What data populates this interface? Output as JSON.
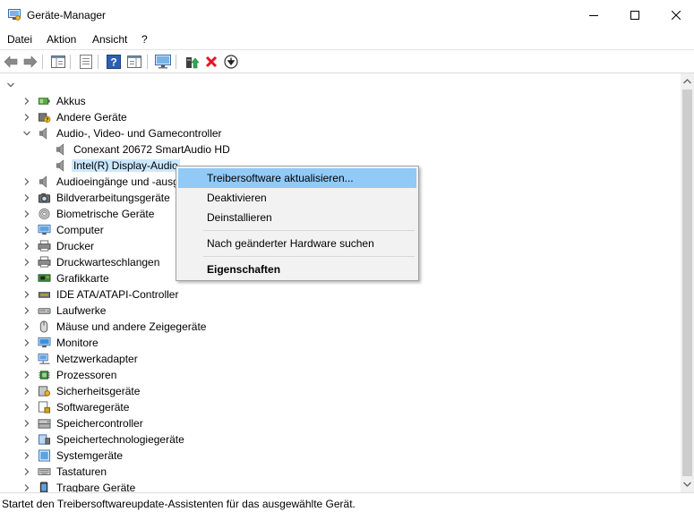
{
  "window": {
    "title": "Geräte-Manager"
  },
  "menu": [
    {
      "label": "Datei"
    },
    {
      "label": "Aktion"
    },
    {
      "label": "Ansicht"
    },
    {
      "label": "?"
    }
  ],
  "tree": {
    "root_label": "",
    "categories": [
      {
        "label": "Akkus",
        "icon": "battery-icon"
      },
      {
        "label": "Andere Geräte",
        "icon": "unknown-device-icon"
      },
      {
        "label": "Audio-, Video- und Gamecontroller",
        "icon": "speaker-icon",
        "expanded": true
      },
      {
        "label": "Conexant 20672 SmartAudio HD",
        "icon": "speaker-icon",
        "child": true
      },
      {
        "label": "Intel(R) Display-Audio",
        "icon": "speaker-icon",
        "child": true,
        "selected": true
      },
      {
        "label": "Audioeingänge und -ausgänge",
        "icon": "speaker-icon"
      },
      {
        "label": "Bildverarbeitungsgeräte",
        "icon": "camera-icon"
      },
      {
        "label": "Biometrische Geräte",
        "icon": "fingerprint-icon"
      },
      {
        "label": "Computer",
        "icon": "computer-icon"
      },
      {
        "label": "Drucker",
        "icon": "printer-icon"
      },
      {
        "label": "Druckwarteschlangen",
        "icon": "printer-icon"
      },
      {
        "label": "Grafikkarte",
        "icon": "display-adapter-icon"
      },
      {
        "label": "IDE ATA/ATAPI-Controller",
        "icon": "ide-controller-icon"
      },
      {
        "label": "Laufwerke",
        "icon": "disk-drive-icon"
      },
      {
        "label": "Mäuse und andere Zeigegeräte",
        "icon": "mouse-icon"
      },
      {
        "label": "Monitore",
        "icon": "monitor-icon"
      },
      {
        "label": "Netzwerkadapter",
        "icon": "network-adapter-icon"
      },
      {
        "label": "Prozessoren",
        "icon": "processor-icon"
      },
      {
        "label": "Sicherheitsgeräte",
        "icon": "security-device-icon"
      },
      {
        "label": "Softwaregeräte",
        "icon": "software-device-icon"
      },
      {
        "label": "Speichercontroller",
        "icon": "storage-controller-icon"
      },
      {
        "label": "Speichertechnologiegeräte",
        "icon": "storage-tech-icon"
      },
      {
        "label": "Systemgeräte",
        "icon": "system-device-icon"
      },
      {
        "label": "Tastaturen",
        "icon": "keyboard-icon"
      },
      {
        "label": "Tragbare Geräte",
        "icon": "portable-device-icon"
      }
    ]
  },
  "context_menu": [
    {
      "label": "Treibersoftware aktualisieren...",
      "highlighted": true
    },
    {
      "label": "Deaktivieren"
    },
    {
      "label": "Deinstallieren"
    },
    {
      "label": "Nach geänderter Hardware suchen"
    },
    {
      "label": "Eigenschaften",
      "bold": true
    }
  ],
  "status": {
    "text": "Startet den Treibersoftwareupdate-Assistenten für das ausgewählte Gerät."
  },
  "colors": {
    "selection": "#cce8ff",
    "menu_highlight": "#91c9f7",
    "error_red": "#e81123",
    "help_blue": "#2a5fb4"
  }
}
